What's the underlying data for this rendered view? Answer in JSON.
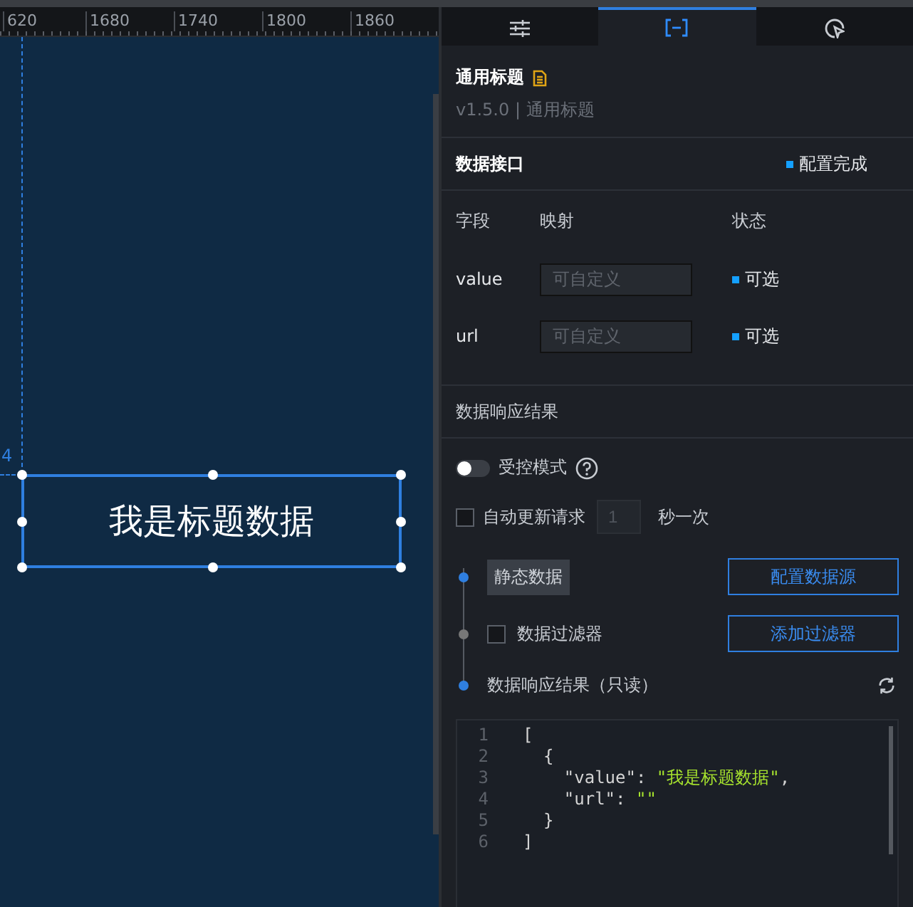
{
  "ruler": {
    "ticks": [
      "620",
      "1680",
      "1740",
      "1800",
      "1860"
    ]
  },
  "canvas": {
    "guide_label": "4",
    "widget": {
      "text": "我是标题数据",
      "selected": true
    }
  },
  "tabs": [
    {
      "kind": "sliders",
      "selected": false
    },
    {
      "kind": "brackets",
      "selected": true
    },
    {
      "kind": "pointer",
      "selected": false
    }
  ],
  "component": {
    "title": "通用标题",
    "version": "v1.5.0 | 通用标题"
  },
  "data_interface": {
    "title": "数据接口",
    "status": "配置完成"
  },
  "columns": [
    "字段",
    "映射",
    "状态"
  ],
  "fields": [
    {
      "name": "value",
      "placeholder": "可自定义",
      "status": "可选"
    },
    {
      "name": "url",
      "placeholder": "可自定义",
      "status": "可选"
    }
  ],
  "response_title": "数据响应结果",
  "controlled_mode": {
    "label": "受控模式",
    "on": false
  },
  "auto_update": {
    "label": "自动更新请求",
    "checked": false,
    "value": "1",
    "unit": "秒一次"
  },
  "steps": [
    {
      "kind": "source",
      "label": "静态数据",
      "active": true,
      "button": "配置数据源"
    },
    {
      "kind": "filter",
      "label": "数据过滤器",
      "active": false,
      "checked": false,
      "button": "添加过滤器"
    },
    {
      "kind": "result",
      "label": "数据响应结果（只读）",
      "active": true
    }
  ],
  "code": [
    {
      "number": "1",
      "tokens": [
        {
          "kind": "punct",
          "text": "["
        }
      ]
    },
    {
      "number": "2",
      "tokens": [
        {
          "kind": "punct",
          "text": "  {"
        }
      ]
    },
    {
      "number": "3",
      "tokens": [
        {
          "kind": "key",
          "text": "    \"value\": "
        },
        {
          "kind": "string",
          "text": "\"我是标题数据\""
        },
        {
          "kind": "punct",
          "text": ","
        }
      ]
    },
    {
      "number": "4",
      "tokens": [
        {
          "kind": "key",
          "text": "    \"url\": "
        },
        {
          "kind": "string",
          "text": "\"\""
        }
      ]
    },
    {
      "number": "5",
      "tokens": [
        {
          "kind": "punct",
          "text": "  }"
        }
      ]
    },
    {
      "number": "6",
      "tokens": [
        {
          "kind": "punct",
          "text": "]"
        }
      ]
    }
  ]
}
